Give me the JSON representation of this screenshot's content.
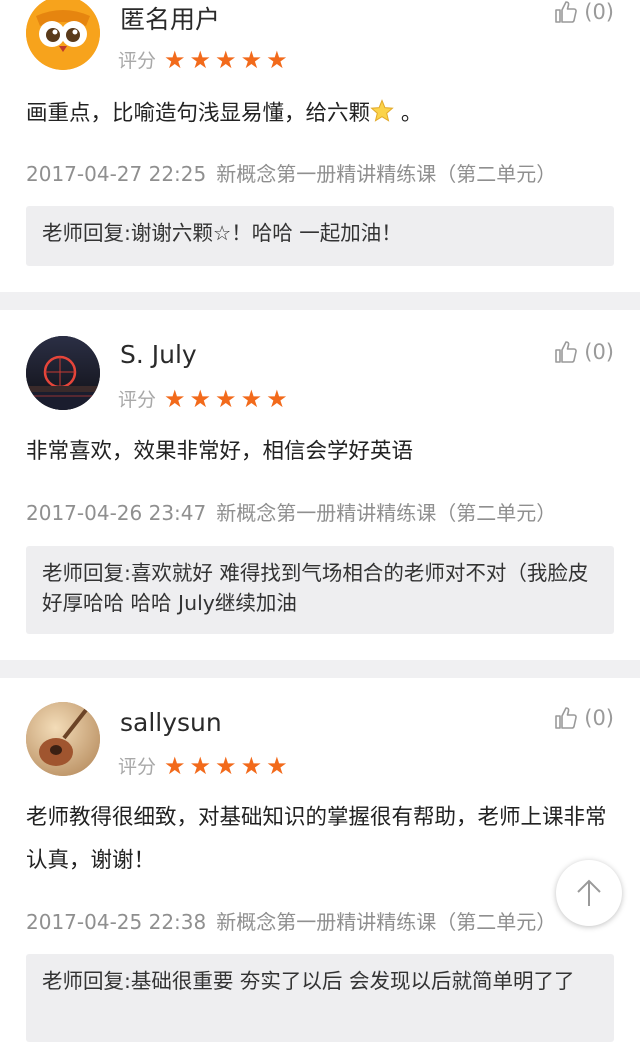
{
  "rating_label": "评分",
  "reviews": [
    {
      "username": "匿名用户",
      "likes": "(0)",
      "stars": 5,
      "content_text": "画重点，比喻造句浅显易懂，给六颗",
      "content_suffix": " 。",
      "date": "2017-04-27 22:25",
      "course": "新概念第一册精讲精练课（第二单元）",
      "reply": "老师回复:谢谢六颗☆！哈哈 一起加油！"
    },
    {
      "username": "S. July",
      "likes": "(0)",
      "stars": 5,
      "content_text": "非常喜欢，效果非常好，相信会学好英语",
      "date": "2017-04-26 23:47",
      "course": "新概念第一册精讲精练课（第二单元）",
      "reply": "老师回复:喜欢就好 难得找到气场相合的老师对不对（我脸皮好厚哈哈 哈哈 July继续加油"
    },
    {
      "username": "sallysun",
      "likes": "(0)",
      "stars": 5,
      "content_text": "老师教得很细致，对基础知识的掌握很有帮助，老师上课非常认真，谢谢！",
      "date": "2017-04-25 22:38",
      "course": "新概念第一册精讲精练课（第二单元）",
      "reply": "老师回复:基础很重要 夯实了以后 会发现以后就简单明了了"
    }
  ],
  "colors": {
    "star": "#f26a1b",
    "separator": "#f0f0f2",
    "reply_bg": "#eeeef0"
  },
  "icons": {
    "like": "thumbs-up-icon",
    "scroll_top": "arrow-up-icon",
    "star": "star-icon"
  }
}
